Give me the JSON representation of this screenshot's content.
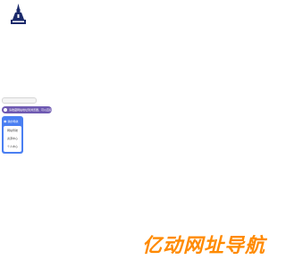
{
  "logo": {
    "icon": "tower-logo-icon",
    "color": "#1b2a6b"
  },
  "search": {
    "placeholder": ""
  },
  "notice": {
    "text": "请收藏网站地址到浏览器，可以直接访问",
    "color": "#6f5ab2"
  },
  "nav": {
    "header_icon": "bookmark-icon",
    "header_symbol": "◉",
    "header_label": "我的导航",
    "items": [
      {
        "label": "网站导航"
      },
      {
        "label": "资源中心"
      },
      {
        "label": "个人中心"
      }
    ],
    "accent": "#4a7ff2"
  },
  "footer": {
    "brand": "亿动网址导航",
    "color": "#ff8a00"
  }
}
